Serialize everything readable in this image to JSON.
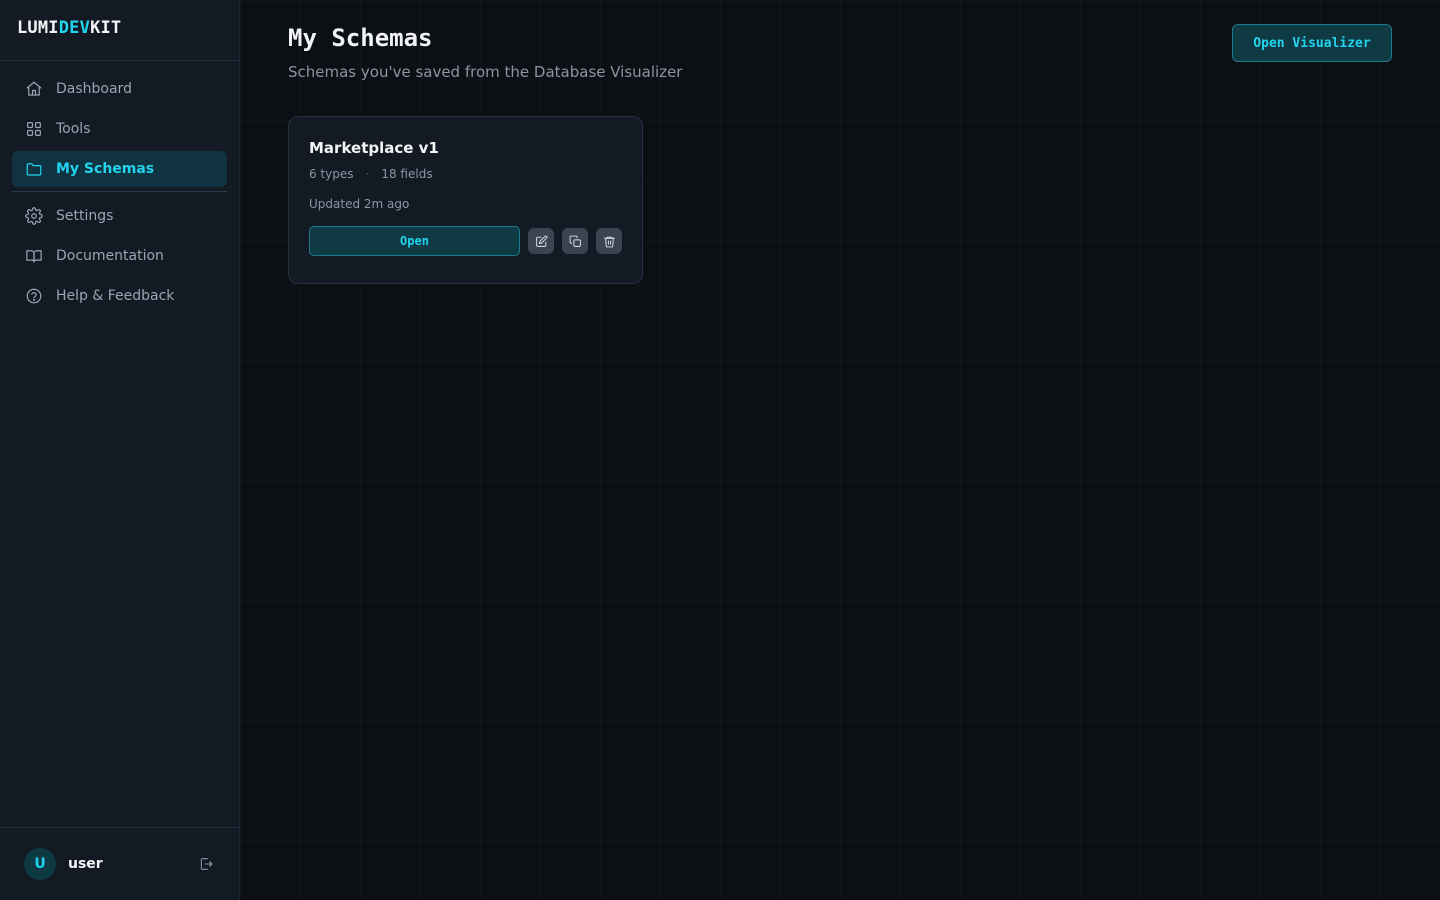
{
  "brand": {
    "part1": "LUMI",
    "part2": "DEV",
    "part3": "KIT"
  },
  "sidebar": {
    "items": [
      {
        "label": "Dashboard",
        "icon": "home-icon"
      },
      {
        "label": "Tools",
        "icon": "grid-icon"
      },
      {
        "label": "My Schemas",
        "icon": "folder-icon",
        "active": true
      },
      {
        "label": "Settings",
        "icon": "gear-icon"
      },
      {
        "label": "Documentation",
        "icon": "book-icon"
      },
      {
        "label": "Help & Feedback",
        "icon": "help-circle-icon"
      }
    ]
  },
  "user": {
    "initial": "U",
    "name": "user",
    "logout_icon": "logout-icon"
  },
  "header": {
    "title": "My Schemas",
    "subtitle": "Schemas you've saved from the Database Visualizer",
    "open_visualizer_label": "Open Visualizer"
  },
  "schemas": [
    {
      "name": "Marketplace v1",
      "types": "6 types",
      "separator": "·",
      "fields": "18 fields",
      "updated": "Updated 2m ago",
      "open_label": "Open",
      "actions": [
        "edit-icon",
        "copy-icon",
        "trash-icon"
      ]
    }
  ],
  "colors": {
    "accent": "#22d3ee",
    "background": "#0c0f14",
    "sidebar": "#131a24",
    "active_bg": "#0f3340"
  }
}
